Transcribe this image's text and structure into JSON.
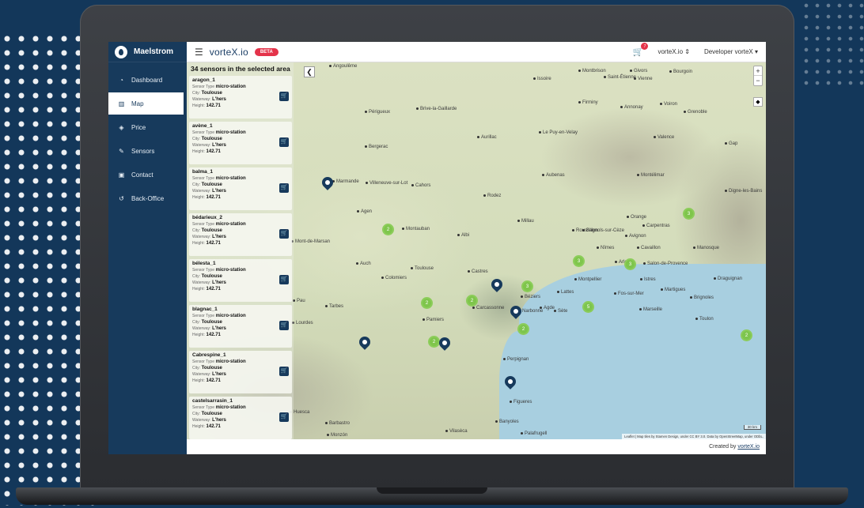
{
  "app": {
    "brand_name": "Maelstrom",
    "logo_text": "vorteX.io",
    "beta_label": "BETA"
  },
  "sidebar": {
    "items": [
      {
        "label": "Dashboard",
        "icon": "gauge-icon"
      },
      {
        "label": "Map",
        "icon": "map-icon",
        "active": true
      },
      {
        "label": "Price",
        "icon": "tag-icon"
      },
      {
        "label": "Sensors",
        "icon": "sensor-icon"
      },
      {
        "label": "Contact",
        "icon": "contact-icon"
      },
      {
        "label": "Back-Office",
        "icon": "back-office-icon"
      }
    ]
  },
  "topbar": {
    "cart_count": "7",
    "org_select": "vorteX.io ⇕",
    "user_menu": "Developer vorteX ▾"
  },
  "panel": {
    "title": "34 sensors in the selected area",
    "labels": {
      "sensor_type": "Sensor Type",
      "city": "City:",
      "waterway": "Waterway:",
      "height": "Height:"
    },
    "sensors": [
      {
        "name": "aragon_1",
        "type": "micro-station",
        "city": "Toulouse",
        "waterway": "L'hers",
        "height": "142.71"
      },
      {
        "name": "avène_1",
        "type": "micro-station",
        "city": "Toulouse",
        "waterway": "L'hers",
        "height": "142.71"
      },
      {
        "name": "balma_1",
        "type": "micro-station",
        "city": "Toulouse",
        "waterway": "L'hers",
        "height": "142.71"
      },
      {
        "name": "bédarieux_2",
        "type": "micro-station",
        "city": "Toulouse",
        "waterway": "L'hers",
        "height": "142.71"
      },
      {
        "name": "bélesta_1",
        "type": "micro-station",
        "city": "Toulouse",
        "waterway": "L'hers",
        "height": "142.71"
      },
      {
        "name": "blagnac_1",
        "type": "micro-station",
        "city": "Toulouse",
        "waterway": "L'hers",
        "height": "142.71"
      },
      {
        "name": "Cabrespine_1",
        "type": "micro-station",
        "city": "Toulouse",
        "waterway": "L'hers",
        "height": "142.71"
      },
      {
        "name": "castelsarrasin_1",
        "type": "micro-station",
        "city": "Toulouse",
        "waterway": "L'hers",
        "height": "142.71"
      }
    ]
  },
  "map": {
    "zoom_in": "+",
    "zoom_out": "−",
    "scale": "30 km",
    "attribution": "Leaflet | Map tiles by Stamen Design, under CC BY 3.0. Data by OpenStreetMap, under ODbL.",
    "cities": [
      {
        "name": "Angoulême"
      },
      {
        "name": "Périgueux"
      },
      {
        "name": "Brive-la-Gaillarde"
      },
      {
        "name": "Aurillac"
      },
      {
        "name": "Le Puy-en-Velay"
      },
      {
        "name": "Montbrison"
      },
      {
        "name": "Saint-Étienne"
      },
      {
        "name": "Vienne"
      },
      {
        "name": "Firminy"
      },
      {
        "name": "Annonay"
      },
      {
        "name": "Voiron"
      },
      {
        "name": "Grenoble"
      },
      {
        "name": "Valence"
      },
      {
        "name": "Bergerac"
      },
      {
        "name": "Marmande"
      },
      {
        "name": "Villeneuve-sur-Lot"
      },
      {
        "name": "Cahors"
      },
      {
        "name": "Rodez"
      },
      {
        "name": "Agen"
      },
      {
        "name": "Montauban"
      },
      {
        "name": "Millau"
      },
      {
        "name": "Albi"
      },
      {
        "name": "Auch"
      },
      {
        "name": "Toulouse"
      },
      {
        "name": "Colomiers"
      },
      {
        "name": "Castres"
      },
      {
        "name": "Nîmes"
      },
      {
        "name": "Arles"
      },
      {
        "name": "Orange"
      },
      {
        "name": "Carpentras"
      },
      {
        "name": "Avignon"
      },
      {
        "name": "Cavaillon"
      },
      {
        "name": "Manosque"
      },
      {
        "name": "Salon-de-Provence"
      },
      {
        "name": "Istres"
      },
      {
        "name": "Martigues"
      },
      {
        "name": "Marseille"
      },
      {
        "name": "Toulon"
      },
      {
        "name": "Draguignan"
      },
      {
        "name": "Montpellier"
      },
      {
        "name": "Lattes"
      },
      {
        "name": "Sète"
      },
      {
        "name": "Agde"
      },
      {
        "name": "Béziers"
      },
      {
        "name": "Narbonne"
      },
      {
        "name": "Carcassonne"
      },
      {
        "name": "Pamiers"
      },
      {
        "name": "Tarbes"
      },
      {
        "name": "Lourdes"
      },
      {
        "name": "Pau"
      },
      {
        "name": "Perpignan"
      },
      {
        "name": "Figueres"
      },
      {
        "name": "Montélimar"
      },
      {
        "name": "Bagnols-sur-Cèze"
      },
      {
        "name": "Fos-sur-Mer"
      },
      {
        "name": "Brignoles"
      },
      {
        "name": "Mont-de-Marsan"
      },
      {
        "name": "Huesca"
      },
      {
        "name": "Barbastro"
      },
      {
        "name": "Monzón"
      },
      {
        "name": "Vilasèca"
      },
      {
        "name": "Palafrugell"
      },
      {
        "name": "Banyoles"
      },
      {
        "name": "Aubenas"
      },
      {
        "name": "Roussillon"
      },
      {
        "name": "Gap"
      },
      {
        "name": "Digne-les-Bains"
      },
      {
        "name": "Bourgoin"
      },
      {
        "name": "Givors"
      },
      {
        "name": "Issoire"
      }
    ],
    "clusters": [
      "2",
      "3",
      "3",
      "5",
      "3",
      "3",
      "2",
      "2",
      "2",
      "2",
      "2"
    ]
  },
  "footer": {
    "prefix": "Created by",
    "link": "vorteX.io"
  }
}
